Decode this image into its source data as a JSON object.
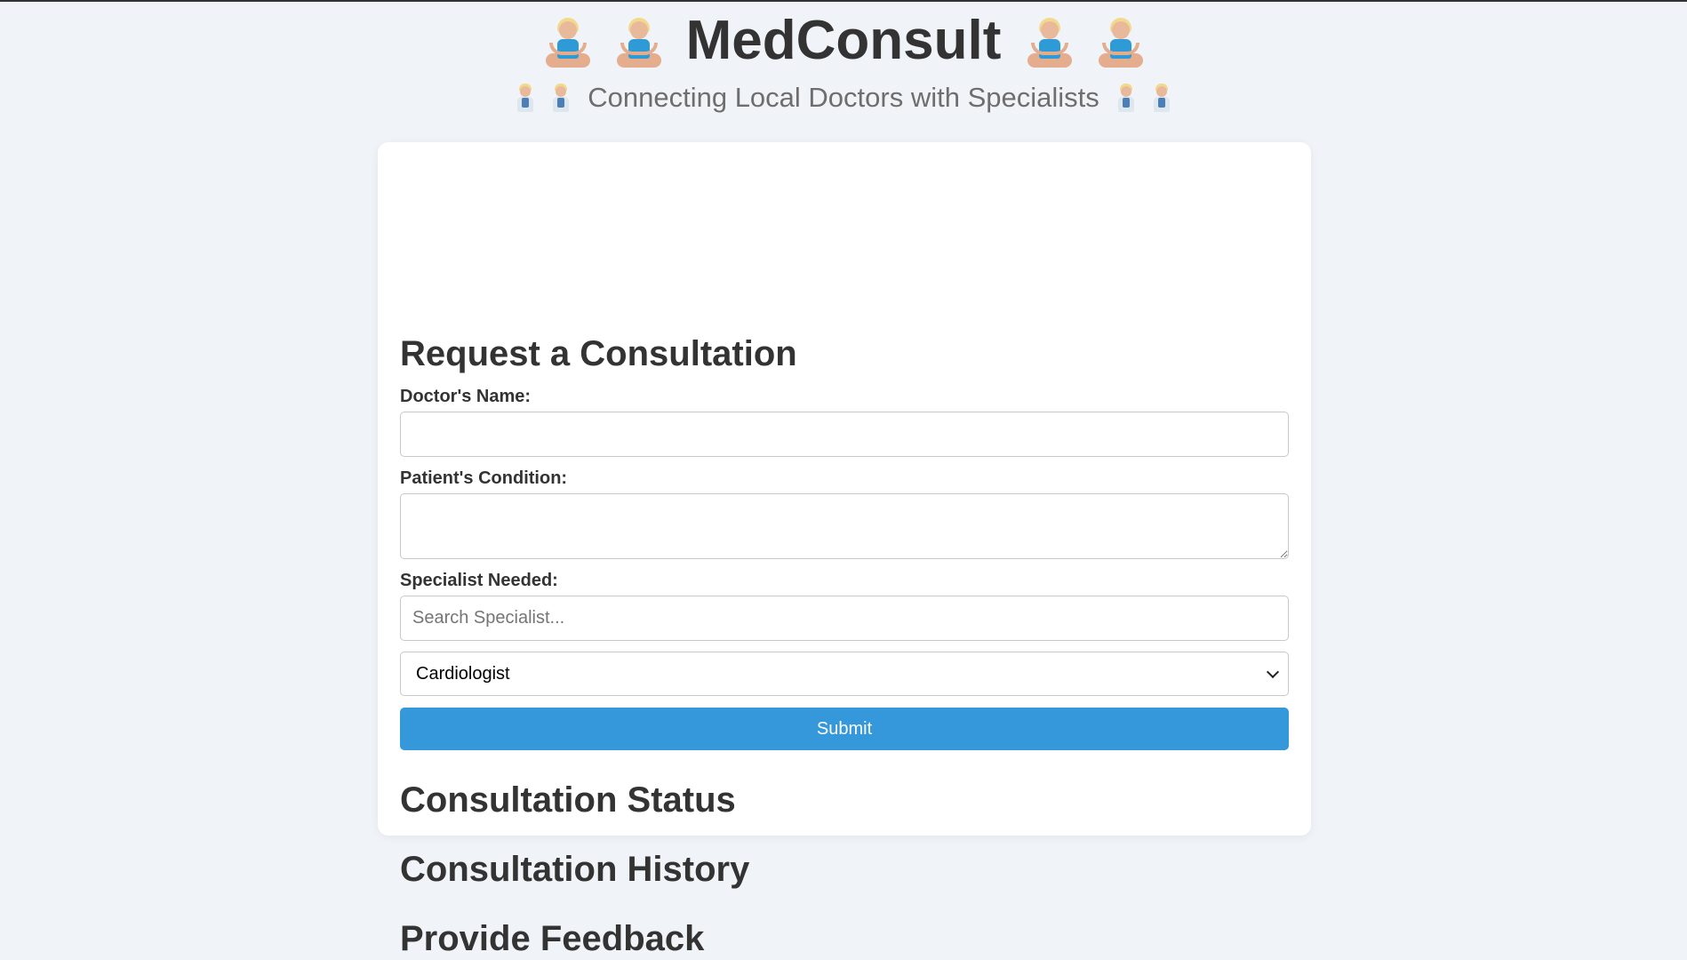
{
  "app": {
    "title": "MedConsult",
    "subtitle": "Connecting Local Doctors with Specialists"
  },
  "icons": {
    "title_icon": "person-in-lotus-position-icon",
    "subtitle_icon": "doctor-icon"
  },
  "consultation_form": {
    "heading": "Request a Consultation",
    "doctor_name_label": "Doctor's Name:",
    "doctor_name_value": "",
    "patient_condition_label": "Patient's Condition:",
    "patient_condition_value": "",
    "specialist_label": "Specialist Needed:",
    "specialist_search_placeholder": "Search Specialist...",
    "specialist_search_value": "",
    "specialist_selected": "Cardiologist",
    "submit_label": "Submit"
  },
  "sections": {
    "status_heading": "Consultation Status",
    "history_heading": "Consultation History",
    "feedback_heading": "Provide Feedback"
  },
  "colors": {
    "background": "#f0f4f8",
    "card": "#ffffff",
    "accent": "#3498db",
    "text": "#333333",
    "subtitle": "#6e6e6e"
  }
}
